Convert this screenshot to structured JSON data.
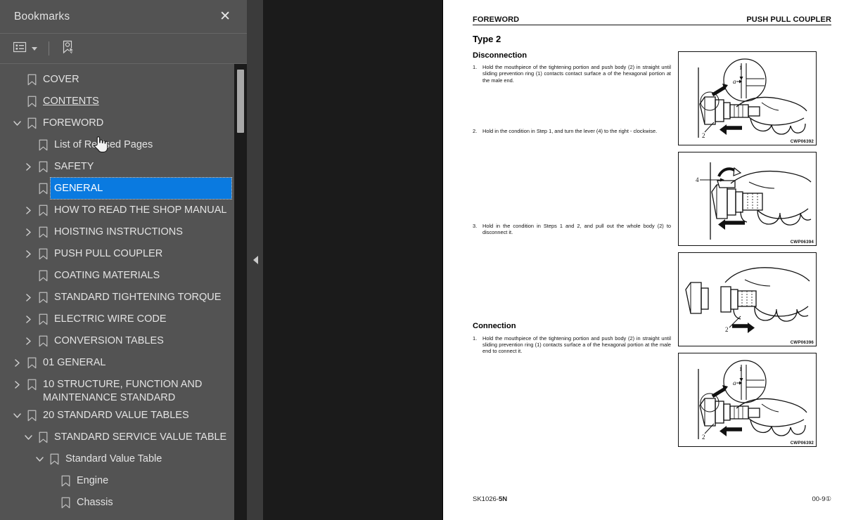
{
  "panel": {
    "title": "Bookmarks",
    "close_label": "✕",
    "toolbar": {
      "options_label": "list-options",
      "new_bookmark_label": "new-bookmark"
    }
  },
  "tree": [
    {
      "label": "COVER",
      "depth": 0,
      "twisty": "none",
      "selected": false,
      "underline": false
    },
    {
      "label": "CONTENTS",
      "depth": 0,
      "twisty": "none",
      "selected": false,
      "underline": true
    },
    {
      "label": "FOREWORD",
      "depth": 0,
      "twisty": "expanded",
      "selected": false,
      "underline": false
    },
    {
      "label": "List of Revised Pages",
      "depth": 1,
      "twisty": "none",
      "selected": false,
      "underline": false
    },
    {
      "label": "SAFETY",
      "depth": 1,
      "twisty": "collapsed",
      "selected": false,
      "underline": false
    },
    {
      "label": "GENERAL",
      "depth": 1,
      "twisty": "none",
      "selected": true,
      "underline": false
    },
    {
      "label": "HOW TO READ THE SHOP MANUAL",
      "depth": 1,
      "twisty": "collapsed",
      "selected": false,
      "underline": false
    },
    {
      "label": "HOISTING INSTRUCTIONS",
      "depth": 1,
      "twisty": "collapsed",
      "selected": false,
      "underline": false
    },
    {
      "label": "PUSH PULL COUPLER",
      "depth": 1,
      "twisty": "collapsed",
      "selected": false,
      "underline": false
    },
    {
      "label": "COATING MATERIALS",
      "depth": 1,
      "twisty": "none",
      "selected": false,
      "underline": false
    },
    {
      "label": "STANDARD TIGHTENING TORQUE",
      "depth": 1,
      "twisty": "collapsed",
      "selected": false,
      "underline": false
    },
    {
      "label": "ELECTRIC WIRE CODE",
      "depth": 1,
      "twisty": "collapsed",
      "selected": false,
      "underline": false
    },
    {
      "label": "CONVERSION TABLES",
      "depth": 1,
      "twisty": "collapsed",
      "selected": false,
      "underline": false
    },
    {
      "label": "01 GENERAL",
      "depth": 0,
      "twisty": "collapsed",
      "selected": false,
      "underline": false
    },
    {
      "label": "10 STRUCTURE, FUNCTION AND\nMAINTENANCE STANDARD",
      "depth": 0,
      "twisty": "collapsed",
      "selected": false,
      "underline": false
    },
    {
      "label": "20 STANDARD VALUE TABLES",
      "depth": 0,
      "twisty": "expanded",
      "selected": false,
      "underline": false
    },
    {
      "label": "STANDARD SERVICE VALUE TABLE",
      "depth": 1,
      "twisty": "expanded",
      "selected": false,
      "underline": false
    },
    {
      "label": "Standard Value Table",
      "depth": 2,
      "twisty": "expanded",
      "selected": false,
      "underline": false
    },
    {
      "label": "Engine",
      "depth": 3,
      "twisty": "none",
      "selected": false,
      "underline": false
    },
    {
      "label": "Chassis",
      "depth": 3,
      "twisty": "none",
      "selected": false,
      "underline": false
    }
  ],
  "document": {
    "header_left": "FOREWORD",
    "header_right": "PUSH PULL COUPLER",
    "type_title": "Type 2",
    "section_disconnection": "Disconnection",
    "section_connection": "Connection",
    "steps": [
      {
        "num": "1.",
        "text": "Hold the mouthpiece of the tightening portion and push body (2) in straight until sliding prevention ring (1) contacts contact surface a of the hexagonal portion at the male end."
      },
      {
        "num": "2.",
        "text": "Hold in the condition in Step 1, and turn the lever (4) to the right  - clockwise."
      },
      {
        "num": "3.",
        "text": "Hold in the condition in Steps 1 and 2, and pull out the whole body (2) to disconnect it."
      }
    ],
    "connection_steps": [
      {
        "num": "1.",
        "text": "Hold the mouthpiece of the tightening portion and push body (2) in straight until sliding prevention ring (1) contacts surface a of the hexagonal portion at the male end to connect it."
      }
    ],
    "figures": [
      {
        "code": "CWP06392",
        "callouts": [
          "a",
          "1",
          "2"
        ]
      },
      {
        "code": "CWP06394",
        "callouts": [
          "4"
        ]
      },
      {
        "code": "CWP06396",
        "callouts": [
          "2"
        ]
      },
      {
        "code": "CWP06392",
        "callouts": [
          "a",
          "1",
          "2"
        ]
      }
    ],
    "footer_left_main": "SK1026-",
    "footer_left_bold": "5N",
    "footer_right": "00-9①"
  },
  "colors": {
    "panel_bg": "#535353",
    "selection": "#0a7ae0",
    "viewer_bg": "#1b1b1b",
    "gutter": "#3b3b3b",
    "page": "#ffffff"
  }
}
